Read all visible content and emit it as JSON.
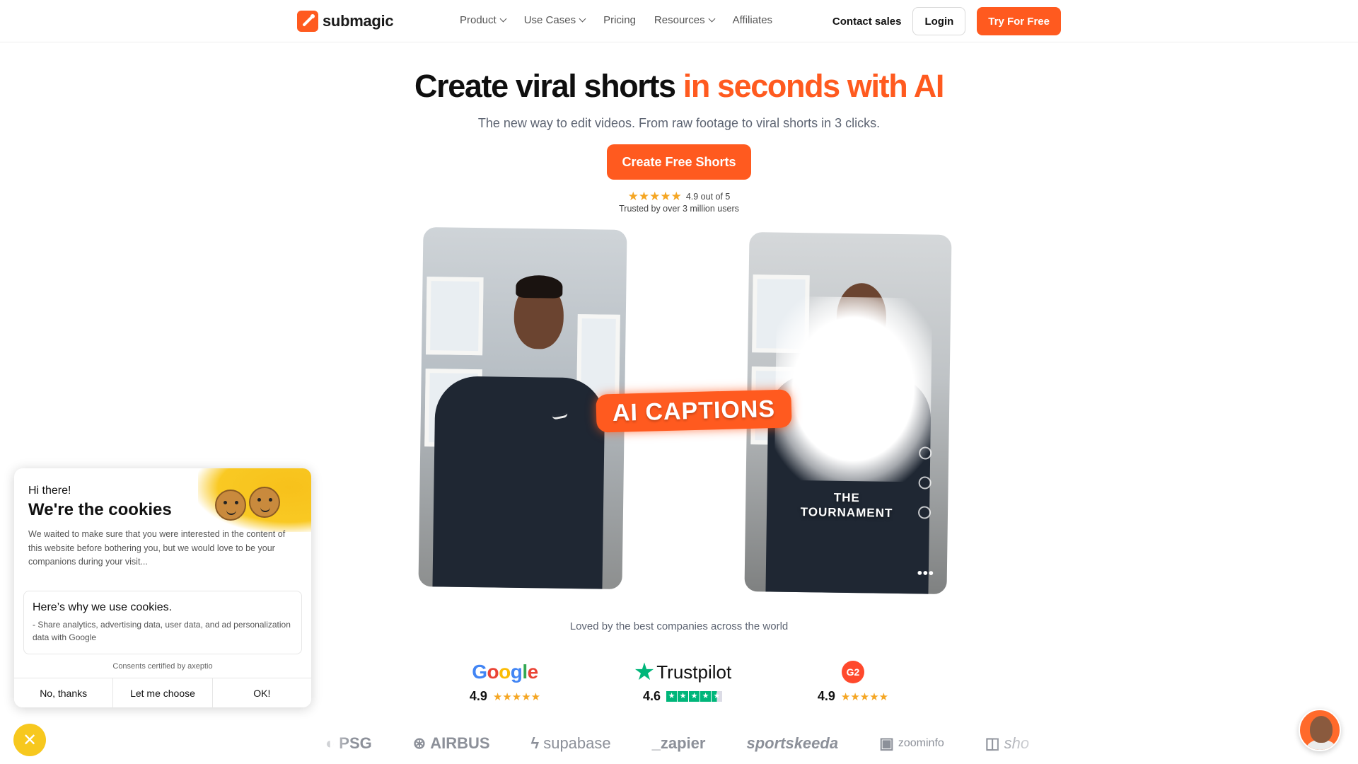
{
  "header": {
    "brand": "submagic",
    "nav": [
      {
        "label": "Product",
        "dropdown": true
      },
      {
        "label": "Use Cases",
        "dropdown": true
      },
      {
        "label": "Pricing",
        "dropdown": false
      },
      {
        "label": "Resources",
        "dropdown": true
      },
      {
        "label": "Affiliates",
        "dropdown": false
      }
    ],
    "contact_sales": "Contact sales",
    "login": "Login",
    "try_free": "Try For Free"
  },
  "hero": {
    "title_main": "Create viral shorts",
    "title_accent": "in seconds with AI",
    "subtitle": "The new way to edit videos. From raw footage to viral shorts in 3 clicks.",
    "cta": "Create Free Shorts",
    "rating_value": "4.9 out of 5",
    "rating_stars": 5,
    "trusted": "Trusted by over 3 million users"
  },
  "demo": {
    "badge": "AI CAPTIONS",
    "caption_line1": "THE",
    "caption_line2": "TOURNAMENT",
    "more": "•••"
  },
  "social_proof": {
    "loved": "Loved by the best companies across the world",
    "reviews": [
      {
        "platform": "Google",
        "score": "4.9"
      },
      {
        "platform": "Trustpilot",
        "score": "4.6"
      },
      {
        "platform": "G2",
        "score": "4.9"
      }
    ],
    "companies": [
      "PSG",
      "AIRBUS",
      "supabase",
      "_zapier",
      "sportskeeda",
      "zoominfo",
      "sho"
    ]
  },
  "cookie": {
    "hi": "Hi there!",
    "title": "We're the cookies",
    "body": "We waited to make sure that you were interested in the content of this website before bothering you, but we would love to be your companions during your visit...",
    "why_title": "Here’s why we use cookies.",
    "why_item": "- Share analytics, advertising data, user data, and ad personalization data with Google",
    "certified": "Consents certified by axeptio",
    "buttons": {
      "no": "No, thanks",
      "choose": "Let me choose",
      "ok": "OK!"
    }
  },
  "colors": {
    "brand_orange": "#ff5a1f",
    "star_gold": "#f5a623",
    "trustpilot_green": "#00b67a",
    "g2_red": "#ff492c",
    "cookie_yellow": "#f7c81e"
  }
}
